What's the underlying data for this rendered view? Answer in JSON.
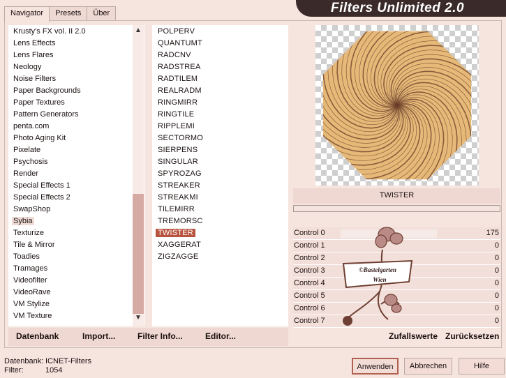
{
  "app": {
    "title": "Filters Unlimited 2.0"
  },
  "tabs": [
    {
      "label": "Navigator",
      "active": true
    },
    {
      "label": "Presets",
      "active": false
    },
    {
      "label": "Über",
      "active": false
    }
  ],
  "categories": {
    "items": [
      "Krusty's FX vol. II 2.0",
      "Lens Effects",
      "Lens Flares",
      "Neology",
      "Noise Filters",
      "Paper Backgrounds",
      "Paper Textures",
      "Pattern Generators",
      "penta.com",
      "Photo Aging Kit",
      "Pixelate",
      "Psychosis",
      "Render",
      "Special Effects 1",
      "Special Effects 2",
      "SwapShop",
      "Sybia",
      "Texturize",
      "Tile & Mirror",
      "Toadies",
      "Tramages",
      "Videofilter",
      "VideoRave",
      "VM Stylize",
      "VM Texture"
    ],
    "selected_index": 16,
    "scroll_up_icon": "▲",
    "scroll_down_icon": "▼"
  },
  "filters": {
    "items": [
      "POLPERV",
      "QUANTUMT",
      "RADCNV",
      "RADSTREA",
      "RADTILEM",
      "REALRADM",
      "RINGMIRR",
      "RINGTILE",
      "RIPPLEMI",
      "SECTORMO",
      "SIERPENS",
      "SINGULAR",
      "SPYROZAG",
      "STREAKER",
      "STREAKMI",
      "TILEMIRR",
      "TREMORSC",
      "TWISTER",
      "XAGGERAT",
      "ZIGZAGGE"
    ],
    "selected_index": 17
  },
  "bottom_links": {
    "datenbank": "Datenbank",
    "import": "Import...",
    "filter_info": "Filter Info...",
    "editor": "Editor..."
  },
  "preview": {
    "filter_name": "TWISTER",
    "fill_color": "#e6b978",
    "stroke_color": "#6a3d2a"
  },
  "controls": [
    {
      "label": "Control 0",
      "value": "175",
      "fraction": 0.69
    },
    {
      "label": "Control 1",
      "value": "0",
      "fraction": 0
    },
    {
      "label": "Control 2",
      "value": "0",
      "fraction": 0
    },
    {
      "label": "Control 3",
      "value": "0",
      "fraction": 0
    },
    {
      "label": "Control 4",
      "value": "0",
      "fraction": 0
    },
    {
      "label": "Control 5",
      "value": "0",
      "fraction": 0
    },
    {
      "label": "Control 6",
      "value": "0",
      "fraction": 0
    },
    {
      "label": "Control 7",
      "value": "0",
      "fraction": 0
    }
  ],
  "control_actions": {
    "randomize": "Zufallswerte",
    "reset": "Zurücksetzen"
  },
  "watermark": {
    "text_line1": "©Bastelgarten",
    "text_line2": "Wien"
  },
  "footer": {
    "database_label": "Datenbank:",
    "database_value": "ICNET-Filters",
    "filter_label": "Filter:",
    "filter_value": "1054",
    "apply": "Anwenden",
    "cancel": "Abbrechen",
    "help": "Hilfe"
  }
}
